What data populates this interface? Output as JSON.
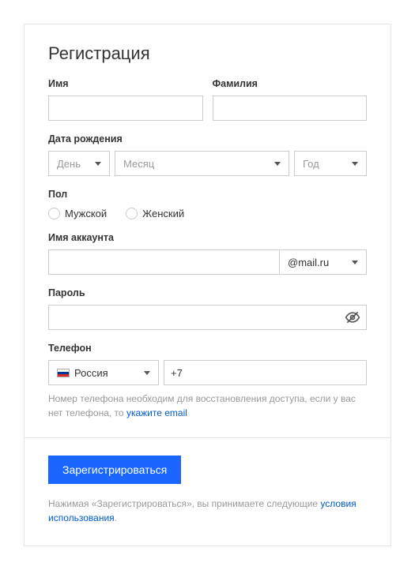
{
  "title": "Регистрация",
  "first_name": {
    "label": "Имя",
    "value": ""
  },
  "last_name": {
    "label": "Фамилия",
    "value": ""
  },
  "dob": {
    "label": "Дата рождения",
    "day_placeholder": "День",
    "month_placeholder": "Месяц",
    "year_placeholder": "Год"
  },
  "gender": {
    "label": "Пол",
    "male": "Мужской",
    "female": "Женский"
  },
  "account": {
    "label": "Имя аккаунта",
    "value": "",
    "domain": "@mail.ru"
  },
  "password": {
    "label": "Пароль",
    "value": ""
  },
  "phone": {
    "label": "Телефон",
    "country_name": "Россия",
    "prefix": "+7",
    "hint_before": "Номер телефона необходим для восстановления доступа, если у вас нет телефона, то ",
    "hint_link": "укажите email"
  },
  "submit_label": "Зарегистрироваться",
  "terms_before": "Нажимая «Зарегистрироваться», вы принимаете следующие ",
  "terms_link": "условия использования",
  "terms_after": "."
}
